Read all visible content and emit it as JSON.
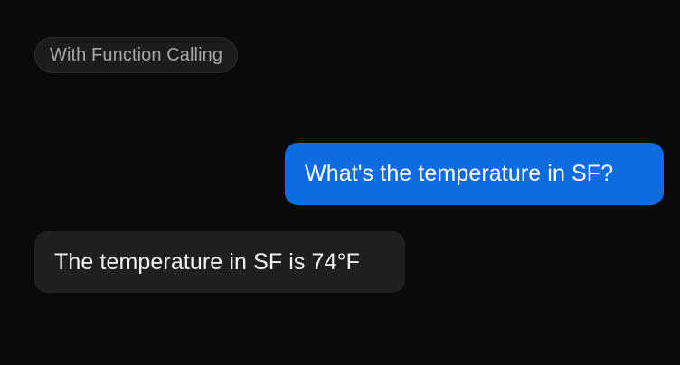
{
  "header": {
    "pill_label": "With Function Calling"
  },
  "conversation": {
    "messages": [
      {
        "role": "user",
        "text": "What's the temperature in SF?"
      },
      {
        "role": "assistant",
        "text": "The temperature in SF is 74°F"
      }
    ]
  },
  "colors": {
    "background": "#0a0a0a",
    "pill_background": "#1c1c1c",
    "pill_text": "#a8a8a8",
    "user_bubble": "#0e6ce3",
    "assistant_bubble": "#1f1f1f"
  }
}
